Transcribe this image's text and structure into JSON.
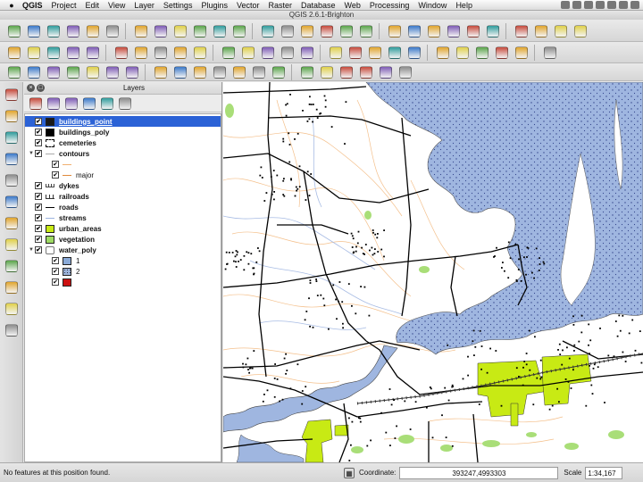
{
  "menubar": {
    "apple": "",
    "app_name": "QGIS",
    "items": [
      "Project",
      "Edit",
      "View",
      "Layer",
      "Settings",
      "Plugins",
      "Vector",
      "Raster",
      "Database",
      "Web",
      "Processing",
      "Window",
      "Help"
    ]
  },
  "window": {
    "title": "QGIS 2.6.1-Brighton"
  },
  "toolbar_icons_row1": [
    "new-project-icon",
    "open-project-icon",
    "save-project-icon",
    "save-as-icon",
    "new-print-composer-icon",
    "composer-manager-icon",
    "pan-icon",
    "pan-to-selection-icon",
    "zoom-in-icon",
    "zoom-out-icon",
    "zoom-full-icon",
    "zoom-to-selection-icon",
    "zoom-to-layer-icon",
    "zoom-last-icon",
    "zoom-next-icon",
    "refresh-icon",
    "identify-icon",
    "select-icon",
    "deselect-icon",
    "measure-icon",
    "field-calculator-icon",
    "open-attribute-table-icon",
    "statistics-icon",
    "map-tips-icon",
    "new-bookmark-icon",
    "show-bookmarks-icon",
    "annotation-icon",
    "text-annotation-icon"
  ],
  "toolbar_icons_row2": [
    "current-edits-icon",
    "toggle-editing-icon",
    "save-edits-icon",
    "add-feature-icon",
    "move-feature-icon",
    "node-tool-icon",
    "delete-selected-icon",
    "cut-features-icon",
    "copy-features-icon",
    "paste-features-icon",
    "label-icon",
    "pin-labels-icon",
    "show-hide-labels-icon",
    "move-label-icon",
    "rotate-label-icon",
    "change-label-icon",
    "add-vector-layer-icon",
    "add-raster-layer-icon",
    "add-postgis-layer-icon",
    "add-spatialite-layer-icon",
    "add-wms-layer-icon",
    "add-wcs-layer-icon",
    "add-wfs-layer-icon",
    "add-csw-icon",
    "add-delimited-text-icon",
    "new-shapefile-icon"
  ],
  "toolbar_icons_row3": [
    "undo-icon",
    "redo-icon",
    "simplify-feature-icon",
    "add-ring-icon",
    "add-part-icon",
    "fill-ring-icon",
    "delete-ring-icon",
    "delete-part-icon",
    "reshape-icon",
    "offset-curve-icon",
    "split-features-icon",
    "split-parts-icon",
    "merge-selected-icon",
    "merge-attributes-icon",
    "rotate-point-symbols-icon",
    "csw-icon",
    "rotate-icon",
    "refresh-icon",
    "gps-icon",
    "georeferencer-icon"
  ],
  "left_toolbar_icons": [
    "add-vector-layer-icon",
    "add-raster-layer-icon",
    "add-postgis-layer-icon",
    "add-spatialite-layer-icon",
    "add-mssql-layer-icon",
    "add-oracle-layer-icon",
    "add-wms-layer-icon",
    "add-wcs-layer-icon",
    "add-wfs-layer-icon",
    "add-delimited-text-icon",
    "new-spatialite-layer-icon",
    "new-temporary-layer-icon"
  ],
  "layers_panel": {
    "title": "Layers",
    "tool_icons": [
      "add-group-icon",
      "manage-visibility-icon",
      "filter-legend-icon",
      "expand-all-icon",
      "collapse-all-icon",
      "remove-layer-icon"
    ],
    "layers": [
      {
        "label": "buildings_point",
        "symbol": "point-square",
        "color": "#1a1a1a",
        "checked": true,
        "selected": true
      },
      {
        "label": "buildings_poly",
        "symbol": "fill",
        "color": "#000000",
        "checked": true
      },
      {
        "label": "cemeteries",
        "symbol": "dashed-box",
        "color": "#000000",
        "checked": true
      },
      {
        "label": "contours",
        "symbol": "line",
        "color": "#aaaaaa",
        "checked": true,
        "expanded": true
      },
      {
        "label": "",
        "symbol": "line",
        "color": "#f0b070",
        "checked": true,
        "child": true
      },
      {
        "label": "major",
        "symbol": "line",
        "color": "#e08a3c",
        "checked": true,
        "child": true
      },
      {
        "label": "dykes",
        "symbol": "comb",
        "color": "#444444",
        "checked": true
      },
      {
        "label": "railroads",
        "symbol": "rail",
        "color": "#333333",
        "checked": true
      },
      {
        "label": "roads",
        "symbol": "line",
        "color": "#000000",
        "checked": true
      },
      {
        "label": "streams",
        "symbol": "line",
        "color": "#9bb3e0",
        "checked": true
      },
      {
        "label": "urban_areas",
        "symbol": "fill",
        "color": "#c8ea14",
        "checked": true
      },
      {
        "label": "vegetation",
        "symbol": "fill",
        "color": "#9fdb64",
        "checked": true
      },
      {
        "label": "water_poly",
        "symbol": "polygon-outline",
        "color": "#777777",
        "checked": true,
        "expanded": true
      },
      {
        "label": "1",
        "symbol": "fill",
        "color": "#8aaad8",
        "checked": true,
        "child": true
      },
      {
        "label": "2",
        "symbol": "dotted-fill",
        "color": "#9cb4dc",
        "checked": true,
        "child": true
      },
      {
        "label": "",
        "symbol": "fill",
        "color": "#cc1111",
        "checked": true,
        "child": true
      }
    ]
  },
  "map": {
    "background": "#ffffff",
    "water_color": "#9fb6e0",
    "water_stipple": "#33448c",
    "urban_color": "#c8ea14",
    "vegetation_color": "#a9de78",
    "road_color": "#000000",
    "contour_color": "#f4c08c",
    "stream_color": "#a8bce4"
  },
  "statusbar": {
    "message": "No features at this position found.",
    "render_icon": "render-toggle-icon",
    "coordinate_label": "Coordinate:",
    "coordinate_value": "393247,4993303",
    "scale_label": "Scale",
    "scale_value": "1:34,167"
  }
}
